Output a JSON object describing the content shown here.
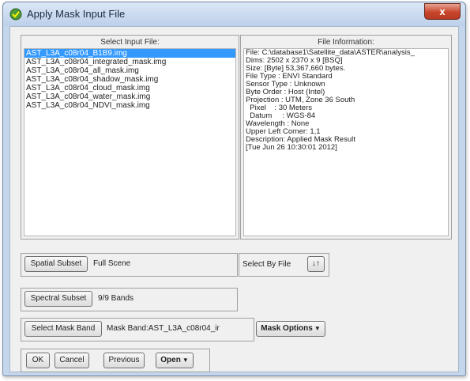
{
  "window": {
    "title": "Apply Mask Input File",
    "close_glyph": "x"
  },
  "input_panel": {
    "title": "Select Input File:",
    "files": [
      "AST_L3A_c08r04_B1B9.img",
      "AST_L3A_c08r04_integrated_mask.img",
      "AST_L3A_c08r04_all_mask.img",
      "AST_L3A_c08r04_shadow_mask.img",
      "AST_L3A_c08r04_cloud_mask.img",
      "AST_L3A_c08r04_water_mask.img",
      "AST_L3A_c08r04_NDVI_mask.img"
    ],
    "selected_index": 0
  },
  "file_info": {
    "title": "File Information:",
    "lines": [
      "File: C:\\database1\\Satellite_data\\ASTER\\analysis_",
      "Dims: 2502 x 2370 x 9 [BSQ]",
      "Size: [Byte] 53,367,660 bytes.",
      "File Type : ENVI Standard",
      "Sensor Type : Unknown",
      "Byte Order : Host (Intel)",
      "Projection : UTM, Zone 36 South",
      "  Pixel    : 30 Meters",
      "  Datum     : WGS-84",
      "Wavelength : None",
      "Upper Left Corner: 1,1",
      "Description: Applied Mask Result",
      "[Tue Jun 26 10:30:01 2012]"
    ]
  },
  "spatial_subset": {
    "button": "Spatial Subset",
    "value": "Full Scene"
  },
  "select_by": {
    "label": "Select By File",
    "icon": "sort-arrows-icon",
    "glyph": "↓↑"
  },
  "spectral_subset": {
    "button": "Spectral Subset",
    "value": "9/9 Bands"
  },
  "mask_band": {
    "button": "Select Mask Band",
    "value": "Mask Band:AST_L3A_c08r04_ir",
    "options_button": "Mask Options"
  },
  "actions": {
    "ok": "OK",
    "cancel": "Cancel",
    "previous": "Previous",
    "open": "Open"
  },
  "colors": {
    "selection": "#3399ff",
    "close_button": "#c7462c"
  }
}
